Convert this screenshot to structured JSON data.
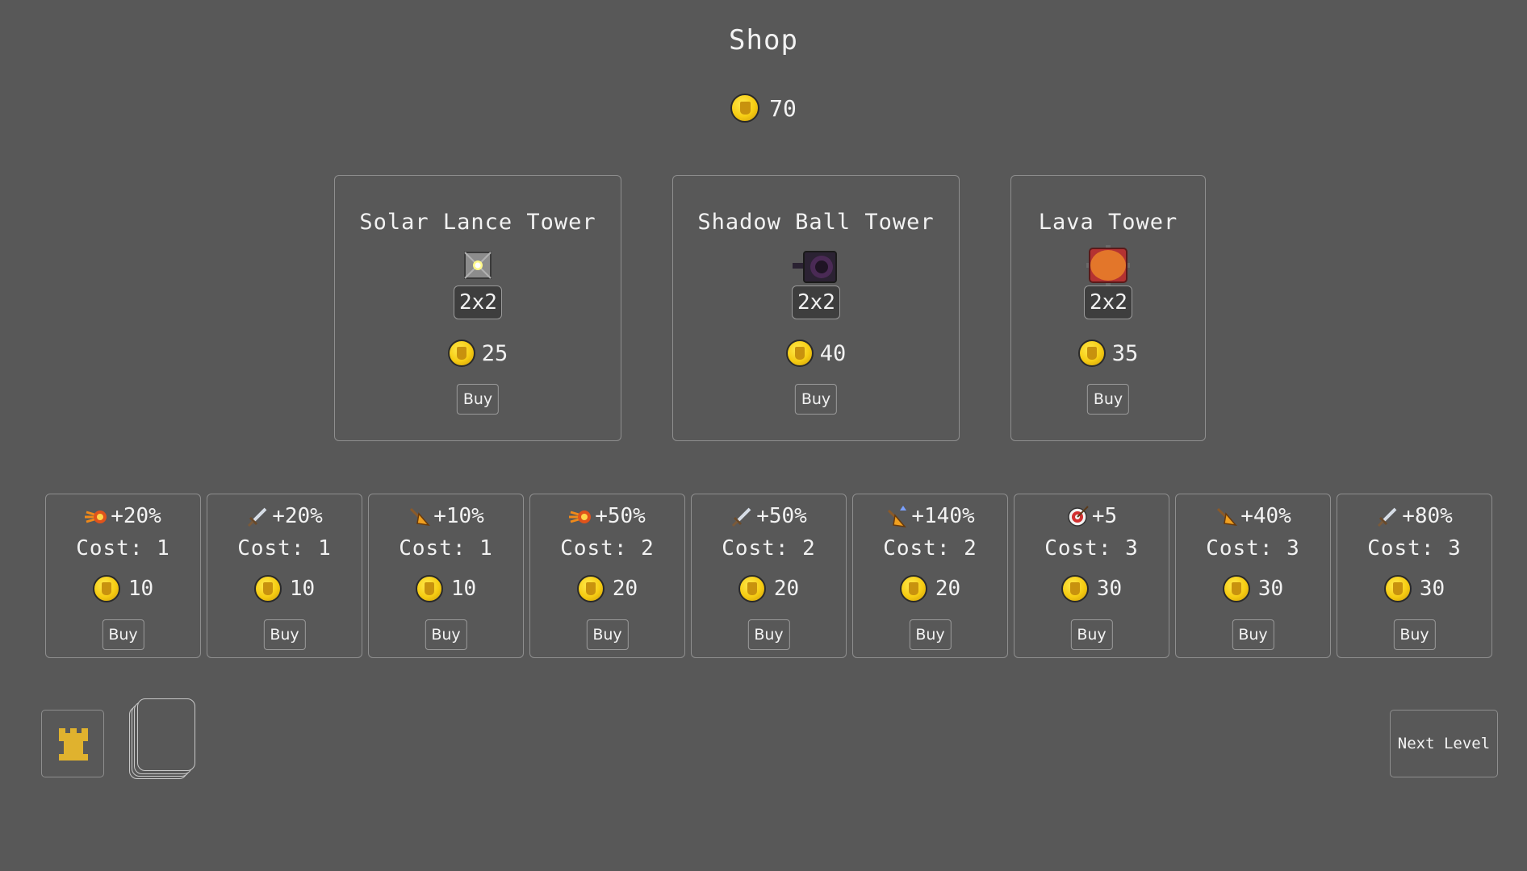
{
  "shop": {
    "title": "Shop",
    "gold": "70"
  },
  "towers": [
    {
      "name": "Solar Lance Tower",
      "size": "2x2",
      "price": "25",
      "buy_label": "Buy",
      "icon": "solar-lance-icon"
    },
    {
      "name": "Shadow Ball Tower",
      "size": "2x2",
      "price": "40",
      "buy_label": "Buy",
      "icon": "shadow-ball-icon"
    },
    {
      "name": "Lava Tower",
      "size": "2x2",
      "price": "35",
      "buy_label": "Buy",
      "icon": "lava-icon"
    }
  ],
  "upgrades": [
    {
      "icon": "fireball-icon",
      "bonus": "+20%",
      "cost": "Cost: 1",
      "price": "10",
      "buy_label": "Buy"
    },
    {
      "icon": "sword-icon",
      "bonus": "+20%",
      "cost": "Cost: 1",
      "price": "10",
      "buy_label": "Buy"
    },
    {
      "icon": "arrow-icon",
      "bonus": "+10%",
      "cost": "Cost: 1",
      "price": "10",
      "buy_label": "Buy"
    },
    {
      "icon": "fireball-icon",
      "bonus": "+50%",
      "cost": "Cost: 2",
      "price": "20",
      "buy_label": "Buy"
    },
    {
      "icon": "sword-icon",
      "bonus": "+50%",
      "cost": "Cost: 2",
      "price": "20",
      "buy_label": "Buy"
    },
    {
      "icon": "arrow-up-icon",
      "bonus": "+140%",
      "cost": "Cost: 2",
      "price": "20",
      "buy_label": "Buy"
    },
    {
      "icon": "target-icon",
      "bonus": "+5",
      "cost": "Cost: 3",
      "price": "30",
      "buy_label": "Buy"
    },
    {
      "icon": "arrow-icon",
      "bonus": "+40%",
      "cost": "Cost: 3",
      "price": "30",
      "buy_label": "Buy"
    },
    {
      "icon": "sword-icon",
      "bonus": "+80%",
      "cost": "Cost: 3",
      "price": "30",
      "buy_label": "Buy"
    }
  ],
  "footer": {
    "next_level_label": "Next Level",
    "tower_slot_icon": "castle-icon",
    "deck_icon": "card-deck-icon"
  },
  "colors": {
    "background": "#585858",
    "coin": "#f6cc12",
    "border": "#8e8e8e",
    "text": "#f2f2f2"
  }
}
